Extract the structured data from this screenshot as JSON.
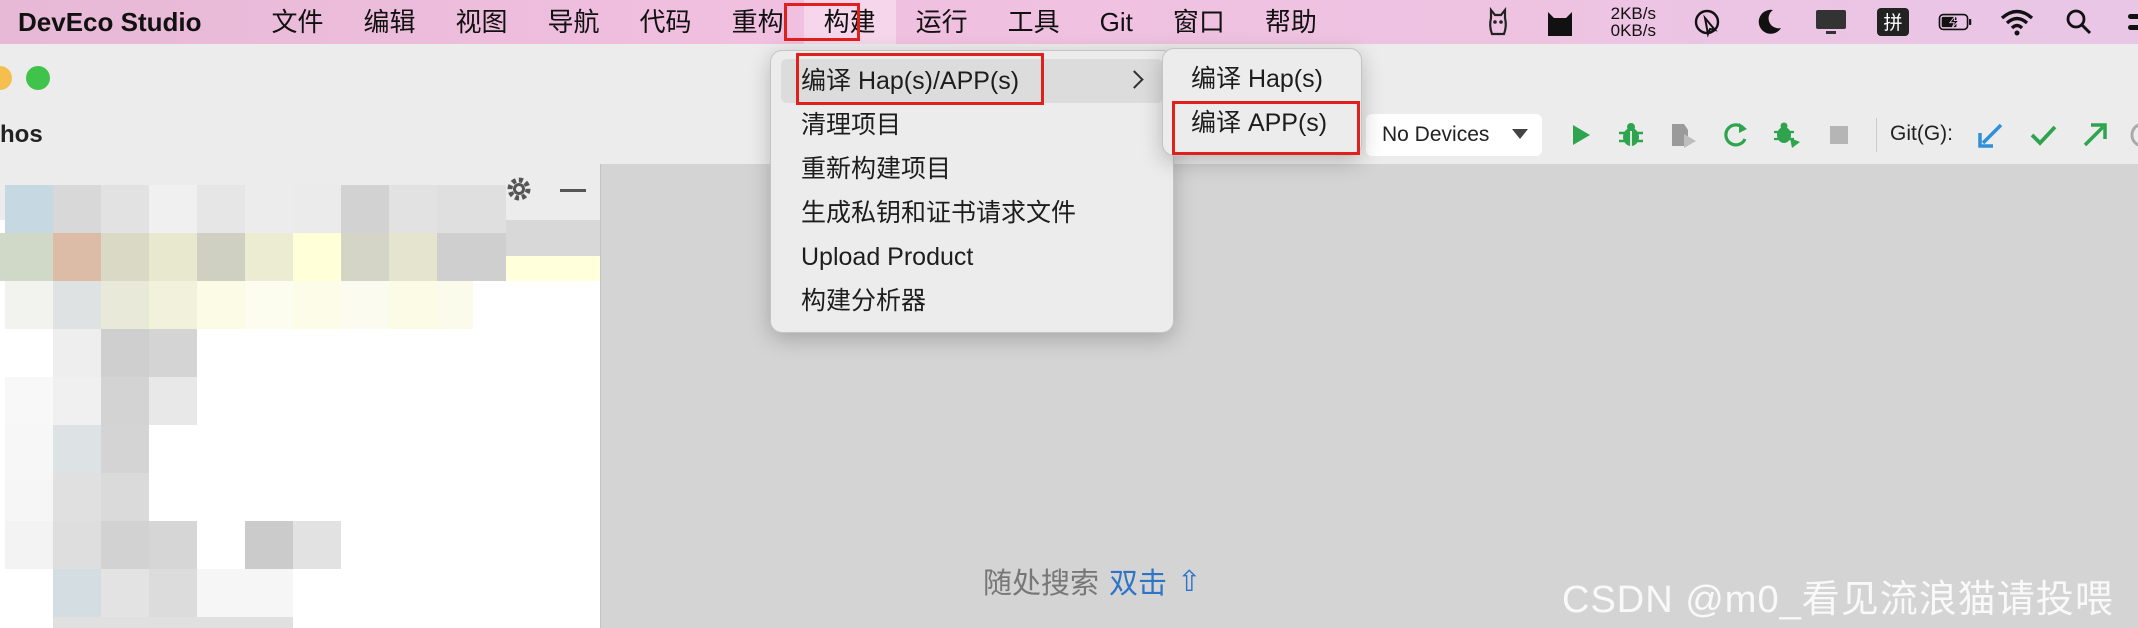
{
  "menubar": {
    "app_name": "DevEco Studio",
    "items": [
      "文件",
      "编辑",
      "视图",
      "导航",
      "代码",
      "重构",
      "构建",
      "运行",
      "工具",
      "Git",
      "窗口",
      "帮助"
    ],
    "active_index": 6,
    "net_up": "2KB/s",
    "net_down": "0KB/s",
    "input_method": "拼"
  },
  "window": {
    "project_name": "hos"
  },
  "toolbar": {
    "devices_label": "No Devices",
    "git_label": "Git(G):"
  },
  "build_menu": {
    "items": [
      "编译 Hap(s)/APP(s)",
      "清理项目",
      "重新构建项目",
      "生成私钥和证书请求文件",
      "Upload Product",
      "构建分析器"
    ],
    "highlighted_index": 0
  },
  "submenu": {
    "items": [
      "编译 Hap(s)",
      "编译 APP(s)"
    ]
  },
  "editor": {
    "search_hint": "随处搜索",
    "search_shortcut": "双击",
    "shortcut_key": "⇧"
  },
  "watermark": "CSDN @m0_看见流浪猫请投喂",
  "colors": {
    "highlight_box": "#e0201c",
    "run_green": "#2ea44f",
    "git_blue": "#2f8fd8"
  }
}
